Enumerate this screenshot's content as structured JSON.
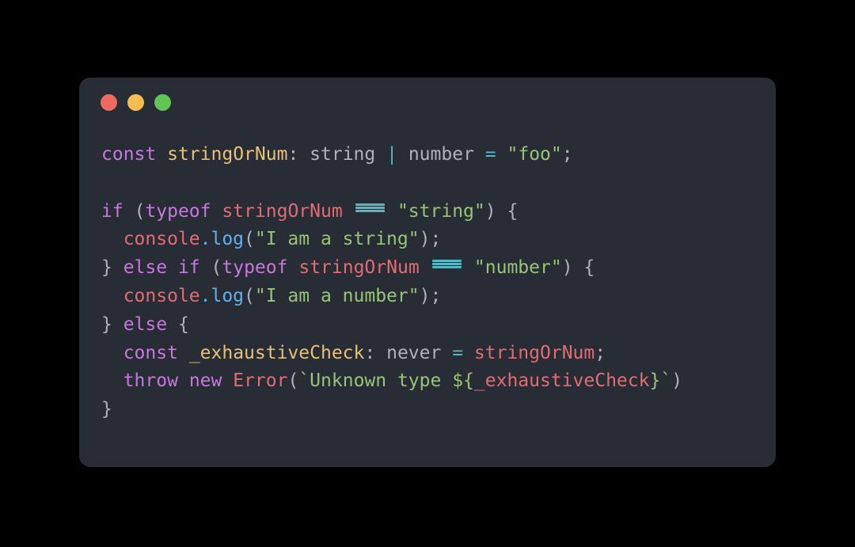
{
  "window": {
    "title": "",
    "controls": [
      {
        "name": "close",
        "icon": "traffic-light-close",
        "color": "#ec6a5e"
      },
      {
        "name": "minimize",
        "icon": "traffic-light-minimize",
        "color": "#f5bd4f"
      },
      {
        "name": "maximize",
        "icon": "traffic-light-maximize",
        "color": "#61c554"
      }
    ]
  },
  "theme": {
    "page_background": "#000000",
    "card_background": "#282c34",
    "keyword": "#c678dd",
    "declaration": "#e5c07b",
    "type": "#abb2bf",
    "variable": "#e06c75",
    "function": "#61afef",
    "string": "#98c379",
    "operator": "#56b6c2",
    "punctuation": "#abb2bf"
  },
  "code": {
    "language": "typescript",
    "lines": [
      {
        "n": 1,
        "text": "const stringOrNum: string | number = \"foo\";"
      },
      {
        "n": 2,
        "text": ""
      },
      {
        "n": 3,
        "text": "if (typeof stringOrNum === \"string\") {"
      },
      {
        "n": 4,
        "text": "  console.log(\"I am a string\");"
      },
      {
        "n": 5,
        "text": "} else if (typeof stringOrNum === \"number\") {"
      },
      {
        "n": 6,
        "text": "  console.log(\"I am a number\");"
      },
      {
        "n": 7,
        "text": "} else {"
      },
      {
        "n": 8,
        "text": "  const _exhaustiveCheck: never = stringOrNum;"
      },
      {
        "n": 9,
        "text": "  throw new Error(`Unknown type ${_exhaustiveCheck}`)"
      },
      {
        "n": 10,
        "text": "}"
      }
    ],
    "tokens": {
      "kw_const": "const",
      "kw_if": "if",
      "kw_else": "else",
      "kw_typeof": "typeof",
      "kw_throw": "throw",
      "kw_new": "new",
      "id_stringOrNum": "stringOrNum",
      "id_exhaustiveCheck": "_exhaustiveCheck",
      "ty_string": "string",
      "ty_number": "number",
      "ty_never": "never",
      "obj_console": "console",
      "fn_log": ".log",
      "cls_Error": "Error",
      "str_foo": "\"foo\"",
      "str_string": "\"string\"",
      "str_number": "\"number\"",
      "str_i_am_a_string": "\"I am a string\"",
      "str_i_am_a_number": "\"I am a number\"",
      "tpl_open": "`Unknown type ",
      "tpl_interp_open": "${",
      "tpl_interp_close": "}",
      "tpl_close": "`",
      "op_union": "|",
      "op_assign": "=",
      "op_strict_equals": "===",
      "p_colon": ":",
      "p_semi": ";",
      "p_lparen": "(",
      "p_rparen": ")",
      "p_lbrace": "{",
      "p_rbrace": "}",
      "sp": " "
    }
  }
}
